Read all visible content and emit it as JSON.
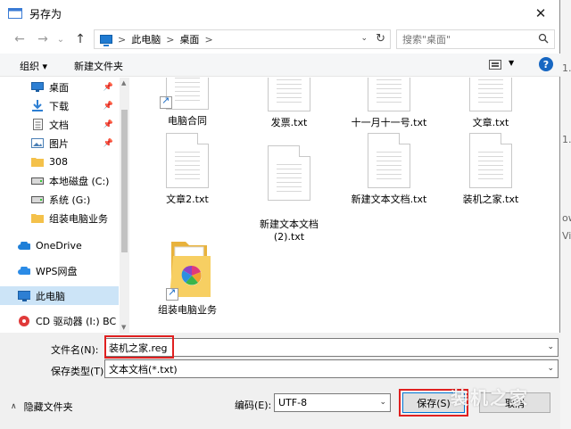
{
  "window": {
    "title": "另存为",
    "close_glyph": "✕",
    "background_fragments": [
      "1.",
      "1.",
      "ow",
      "Vi"
    ]
  },
  "nav": {
    "back_glyph": "←",
    "forward_glyph": "→",
    "recent_glyph": "⌄",
    "up_glyph": "↑"
  },
  "address": {
    "crumbs": [
      "此电脑",
      "桌面"
    ],
    "separator": ">",
    "dropdown_glyph": "⌄",
    "refresh_glyph": "↻"
  },
  "search": {
    "placeholder": "搜索\"桌面\""
  },
  "toolbar": {
    "organize_label": "组织 ▾",
    "new_folder_label": "新建文件夹",
    "view_dropdown_glyph": "▼",
    "help_glyph": "?"
  },
  "sidebar": {
    "items": [
      {
        "label": "桌面",
        "icon": "desktop-icon",
        "pinned": true
      },
      {
        "label": "下载",
        "icon": "download-icon",
        "pinned": true
      },
      {
        "label": "文档",
        "icon": "document-icon",
        "pinned": true
      },
      {
        "label": "图片",
        "icon": "picture-icon",
        "pinned": true
      },
      {
        "label": "308",
        "icon": "folder-icon",
        "pinned": false
      },
      {
        "label": "本地磁盘 (C:)",
        "icon": "drive-icon",
        "pinned": false
      },
      {
        "label": "系统 (G:)",
        "icon": "drive-icon",
        "pinned": false
      },
      {
        "label": "组装电脑业务",
        "icon": "folder-icon",
        "pinned": false
      },
      {
        "label": "OneDrive",
        "icon": "cloud-icon",
        "pinned": false
      },
      {
        "label": "WPS网盘",
        "icon": "wps-cloud-icon",
        "pinned": false
      },
      {
        "label": "此电脑",
        "icon": "computer-icon",
        "pinned": false,
        "selected": true
      },
      {
        "label": "CD 驱动器 (I:) BC",
        "icon": "cd-drive-icon",
        "pinned": false
      }
    ],
    "pin_glyph": "📌"
  },
  "files": [
    {
      "label": "电脑合同",
      "type": "shortcut"
    },
    {
      "label": "发票.txt",
      "type": "text"
    },
    {
      "label": "十一月十一号.txt",
      "type": "text"
    },
    {
      "label": "文章.txt",
      "type": "text"
    },
    {
      "label": "文章2.txt",
      "type": "text"
    },
    {
      "label": "新建文本文档\n(2).txt",
      "type": "text"
    },
    {
      "label": "新建文本文档.txt",
      "type": "text"
    },
    {
      "label": "装机之家.txt",
      "type": "text"
    },
    {
      "label": "组装电脑业务",
      "type": "folder-shortcut"
    }
  ],
  "footer": {
    "filename_label": "文件名(N):",
    "filename_value": "装机之家.reg",
    "filetype_label": "保存类型(T):",
    "filetype_value": "文本文档(*.txt)",
    "hide_folders_label": "隐藏文件夹",
    "hide_folders_glyph": "∧",
    "encoding_label": "编码(E):",
    "encoding_value": "UTF-8",
    "save_label": "保存(S)",
    "cancel_label": "取消",
    "dropdown_glyph": "⌄"
  },
  "watermark_text": "装机之家",
  "colors": {
    "selection": "#cce4f7",
    "highlight_red": "#e02020",
    "accent_blue": "#0078d7",
    "folder_yellow": "#f4c14a"
  }
}
